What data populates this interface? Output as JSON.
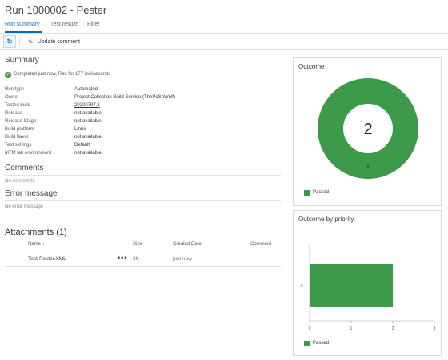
{
  "header": {
    "title": "Run 1000002 - Pester"
  },
  "tabs": [
    {
      "label": "Run summary",
      "active": true
    },
    {
      "label": "Test results",
      "active": false
    },
    {
      "label": "Filter",
      "active": false
    }
  ],
  "toolbar": {
    "refresh_icon": "refresh-icon",
    "update_comment": "Update comment"
  },
  "summary": {
    "heading": "Summary",
    "status": "Completed just now, Ran for 177 milliseconds",
    "fields": [
      {
        "label": "Run type",
        "value": "Automated"
      },
      {
        "label": "Owner",
        "value": "Project Collection Build Service (ThePoShWolf)"
      },
      {
        "label": "Tested build",
        "value": "20200797.3"
      },
      {
        "label": "Release",
        "value": "not available"
      },
      {
        "label": "Release Stage",
        "value": "not available"
      },
      {
        "label": "Build platform",
        "value": "Linux"
      },
      {
        "label": "Build flavor",
        "value": "not available"
      },
      {
        "label": "Test settings",
        "value": "Default"
      },
      {
        "label": "MTM lab environment",
        "value": "not available"
      }
    ]
  },
  "comments": {
    "heading": "Comments",
    "empty": "No comments"
  },
  "error": {
    "heading": "Error message",
    "empty": "No error message"
  },
  "attachments": {
    "heading": "Attachments (1)",
    "columns": {
      "name": "Name",
      "sort_arrow": "↑",
      "size": "Size",
      "created": "Created Date",
      "comment": "Comment"
    },
    "rows": [
      {
        "name": "Test-Pester.XML",
        "menu": "•••",
        "size": "2K",
        "created": "just now",
        "comment": ""
      }
    ]
  },
  "outcome": {
    "title": "Outcome",
    "total": "2",
    "legend": "Passed"
  },
  "priority": {
    "title": "Outcome by priority",
    "legend": "Passed"
  },
  "colors": {
    "accent": "#0b6ab8",
    "passed": "#3c9a4a"
  },
  "chart_data": [
    {
      "type": "pie",
      "title": "Outcome",
      "categories": [
        "Passed"
      ],
      "values": [
        2
      ],
      "center_label": "2",
      "legend": "bottom-left"
    },
    {
      "type": "bar",
      "title": "Outcome by priority",
      "orientation": "horizontal",
      "categories": [
        "0"
      ],
      "series": [
        {
          "name": "Passed",
          "values": [
            2
          ]
        }
      ],
      "xlim": [
        0,
        3
      ],
      "xticks": [
        "0",
        "1",
        "2",
        "3"
      ],
      "legend": "bottom-left"
    }
  ]
}
